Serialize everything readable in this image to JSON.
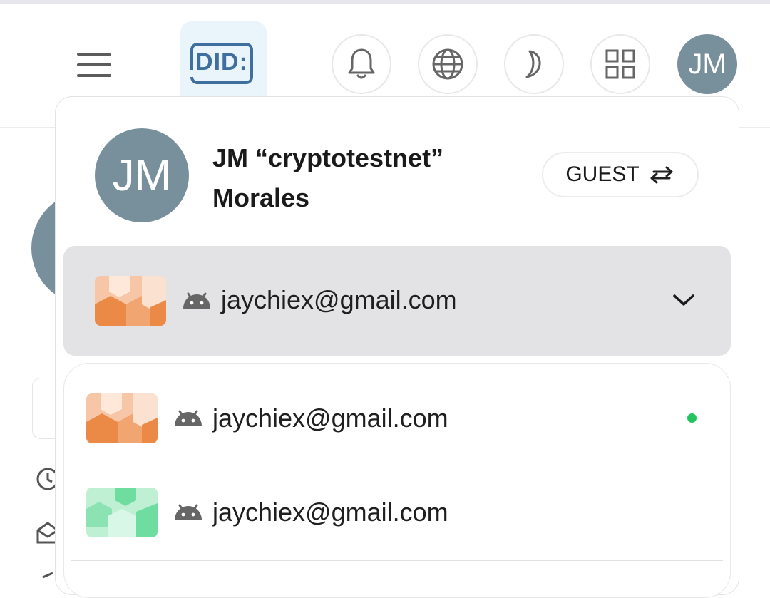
{
  "header": {
    "logo_text": "DID:",
    "avatar_initials": "JM",
    "buttons": [
      "notifications",
      "language",
      "theme",
      "apps"
    ]
  },
  "profile": {
    "initials": "JM",
    "name_line1": "JM “cryptotestnet”",
    "name_line2": "Morales",
    "role_label": "GUEST"
  },
  "selected_account": {
    "email": "jaychiex@gmail.com"
  },
  "accounts": [
    {
      "email": "jaychiex@gmail.com",
      "active": true,
      "thumb_color": "orange"
    },
    {
      "email": "jaychiex@gmail.com",
      "active": false,
      "thumb_color": "green"
    }
  ],
  "colors": {
    "avatar": "#78909c",
    "logo": "#3e6f9f",
    "active_dot": "#22c55e",
    "selector_bg": "#e3e3e6"
  }
}
